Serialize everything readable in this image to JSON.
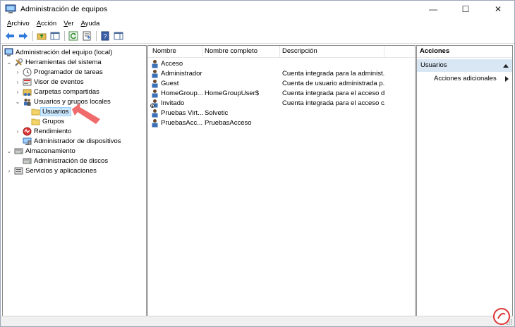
{
  "window": {
    "title": "Administración de equipos",
    "controls": {
      "minimize": "—",
      "maximize": "☐",
      "close": "✕"
    }
  },
  "menu": [
    {
      "first": "A",
      "rest": "rchivo"
    },
    {
      "first": "A",
      "rest": "cción"
    },
    {
      "first": "V",
      "rest": "er"
    },
    {
      "first": "A",
      "rest": "yuda"
    }
  ],
  "tree": {
    "root": "Administración del equipo (local)",
    "system_tools": "Herramientas del sistema",
    "task_scheduler": "Programador de tareas",
    "event_viewer": "Visor de eventos",
    "shared_folders": "Carpetas compartidas",
    "local_users": "Usuarios y grupos locales",
    "users": "Usuarios",
    "groups": "Grupos",
    "performance": "Rendimiento",
    "device_manager": "Administrador de dispositivos",
    "storage": "Almacenamiento",
    "disk_mgmt": "Administración de discos",
    "services": "Servicios y aplicaciones"
  },
  "list": {
    "columns": {
      "name": "Nombre",
      "full_name": "Nombre completo",
      "description": "Descripción"
    },
    "rows": [
      {
        "name": "Acceso",
        "full": "",
        "desc": ""
      },
      {
        "name": "Administrador",
        "full": "",
        "desc": "Cuenta integrada para la administ..."
      },
      {
        "name": "Guest",
        "full": "",
        "desc": "Cuenta de usuario administrada p..."
      },
      {
        "name": "HomeGroup...",
        "full": "HomeGroupUser$",
        "desc": "Cuenta integrada para el acceso d..."
      },
      {
        "name": "Invitado",
        "full": "",
        "desc": "Cuenta integrada para el acceso c..."
      },
      {
        "name": "Pruebas Virt...",
        "full": "Solvetic",
        "desc": ""
      },
      {
        "name": "PruebasAcc...",
        "full": "PruebasAcceso",
        "desc": ""
      }
    ]
  },
  "actions": {
    "header": "Acciones",
    "section": "Usuarios",
    "more": "Acciones adicionales"
  },
  "colors": {
    "selection": "#cce8ff",
    "action_section": "#d9e6f4",
    "arrow": "#f06b6b"
  }
}
